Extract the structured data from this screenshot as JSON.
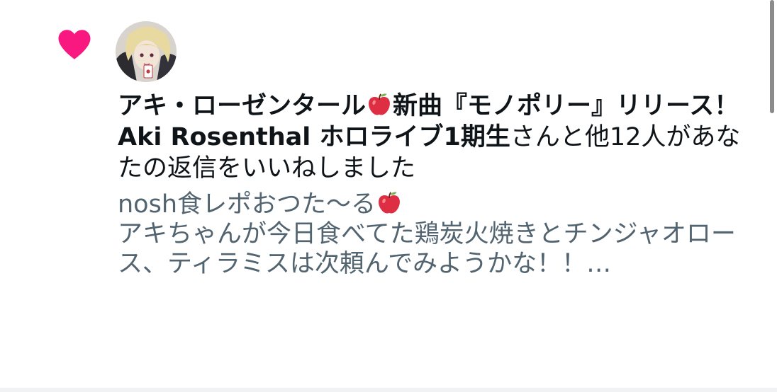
{
  "notification": {
    "liker_name": "アキ・ローゼンタール",
    "liker_name_suffix": "新曲『モノポリー』リリース！Aki Rosenthal ホロライブ1期生",
    "action_text": "さんと他12人があなたの返信をいいねしました",
    "quoted_tweet": {
      "line1_prefix": "nosh食レポおつた〜る",
      "line2": "アキちゃんが今日食べてた鶏炭火焼きとチンジャオロース、ティラミスは次頼んでみようかな！！…"
    }
  },
  "icons": {
    "heart": "heart-icon",
    "apple": "red-apple-icon"
  },
  "colors": {
    "heart": "#f91880",
    "primary_text": "#0f1419",
    "secondary_text": "#536471",
    "divider": "#eff3f4"
  }
}
